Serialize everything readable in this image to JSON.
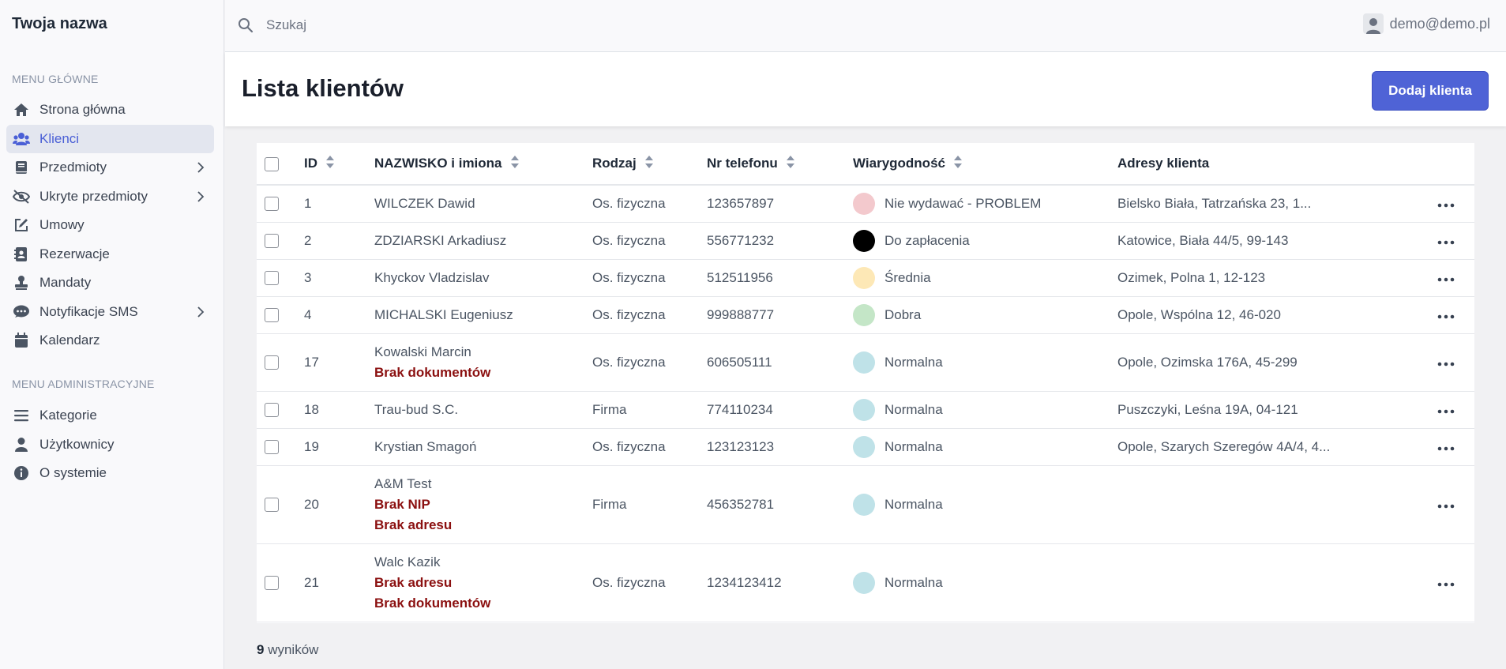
{
  "brand": "Twoja nazwa",
  "menu_main_header": "MENU GŁÓWNE",
  "menu_main": [
    {
      "label": "Strona główna",
      "icon": "home-icon",
      "chevron": false,
      "active": false
    },
    {
      "label": "Klienci",
      "icon": "users-icon",
      "chevron": false,
      "active": true
    },
    {
      "label": "Przedmioty",
      "icon": "book-icon",
      "chevron": true,
      "active": false
    },
    {
      "label": "Ukryte przedmioty",
      "icon": "eye-slash-icon",
      "chevron": true,
      "active": false
    },
    {
      "label": "Umowy",
      "icon": "edit-icon",
      "chevron": false,
      "active": false
    },
    {
      "label": "Rezerwacje",
      "icon": "address-book-icon",
      "chevron": false,
      "active": false
    },
    {
      "label": "Mandaty",
      "icon": "stamp-icon",
      "chevron": false,
      "active": false
    },
    {
      "label": "Notyfikacje SMS",
      "icon": "sms-icon",
      "chevron": true,
      "active": false
    },
    {
      "label": "Kalendarz",
      "icon": "calendar-icon",
      "chevron": false,
      "active": false
    }
  ],
  "menu_admin_header": "MENU ADMINISTRACYJNE",
  "menu_admin": [
    {
      "label": "Kategorie",
      "icon": "bars-icon"
    },
    {
      "label": "Użytkownicy",
      "icon": "user-icon"
    },
    {
      "label": "O systemie",
      "icon": "info-icon"
    }
  ],
  "search": {
    "placeholder": "Szukaj"
  },
  "user": {
    "email": "demo@demo.pl"
  },
  "page": {
    "title": "Lista klientów",
    "add_button": "Dodaj klienta"
  },
  "table": {
    "columns": [
      "ID",
      "NAZWISKO i imiona",
      "Rodzaj",
      "Nr telefonu",
      "Wiarygodność",
      "Adresy klienta"
    ],
    "rows": [
      {
        "id": "1",
        "name": "WILCZEK Dawid",
        "warnings": [],
        "type": "Os. fizyczna",
        "phone": "123657897",
        "credibility": "Nie wydawać - PROBLEM",
        "color": "#f3c9cd",
        "address": "Bielsko Biała, Tatrzańska 23, 1..."
      },
      {
        "id": "2",
        "name": "ZDZIARSKI Arkadiusz",
        "warnings": [],
        "type": "Os. fizyczna",
        "phone": "556771232",
        "credibility": "Do zapłacenia",
        "color": "#000000",
        "address": "Katowice, Biała 44/5, 99-143"
      },
      {
        "id": "3",
        "name": "Khyckov Vladzislav",
        "warnings": [],
        "type": "Os. fizyczna",
        "phone": "512511956",
        "credibility": "Średnia",
        "color": "#fde8b6",
        "address": "Ozimek, Polna 1, 12-123"
      },
      {
        "id": "4",
        "name": "MICHALSKI Eugeniusz",
        "warnings": [],
        "type": "Os. fizyczna",
        "phone": "999888777",
        "credibility": "Dobra",
        "color": "#c4e6c7",
        "address": "Opole, Wspólna 12, 46-020"
      },
      {
        "id": "17",
        "name": "Kowalski Marcin",
        "warnings": [
          "Brak dokumentów"
        ],
        "type": "Os. fizyczna",
        "phone": "606505111",
        "credibility": "Normalna",
        "color": "#bfe2e8",
        "address": "Opole, Ozimska 176A, 45-299"
      },
      {
        "id": "18",
        "name": "Trau-bud S.C.",
        "warnings": [],
        "type": "Firma",
        "phone": "774110234",
        "credibility": "Normalna",
        "color": "#bfe2e8",
        "address": "Puszczyki, Leśna 19A, 04-121"
      },
      {
        "id": "19",
        "name": "Krystian Smagoń",
        "warnings": [],
        "type": "Os. fizyczna",
        "phone": "123123123",
        "credibility": "Normalna",
        "color": "#bfe2e8",
        "address": "Opole, Szarych Szeregów 4A/4, 4..."
      },
      {
        "id": "20",
        "name": "A&M Test",
        "warnings": [
          "Brak NIP",
          "Brak adresu"
        ],
        "type": "Firma",
        "phone": "456352781",
        "credibility": "Normalna",
        "color": "#bfe2e8",
        "address": ""
      },
      {
        "id": "21",
        "name": "Walc Kazik",
        "warnings": [
          "Brak adresu",
          "Brak dokumentów"
        ],
        "type": "Os. fizyczna",
        "phone": "1234123412",
        "credibility": "Normalna",
        "color": "#bfe2e8",
        "address": ""
      }
    ]
  },
  "results": {
    "count": "9",
    "label": "wyników"
  }
}
